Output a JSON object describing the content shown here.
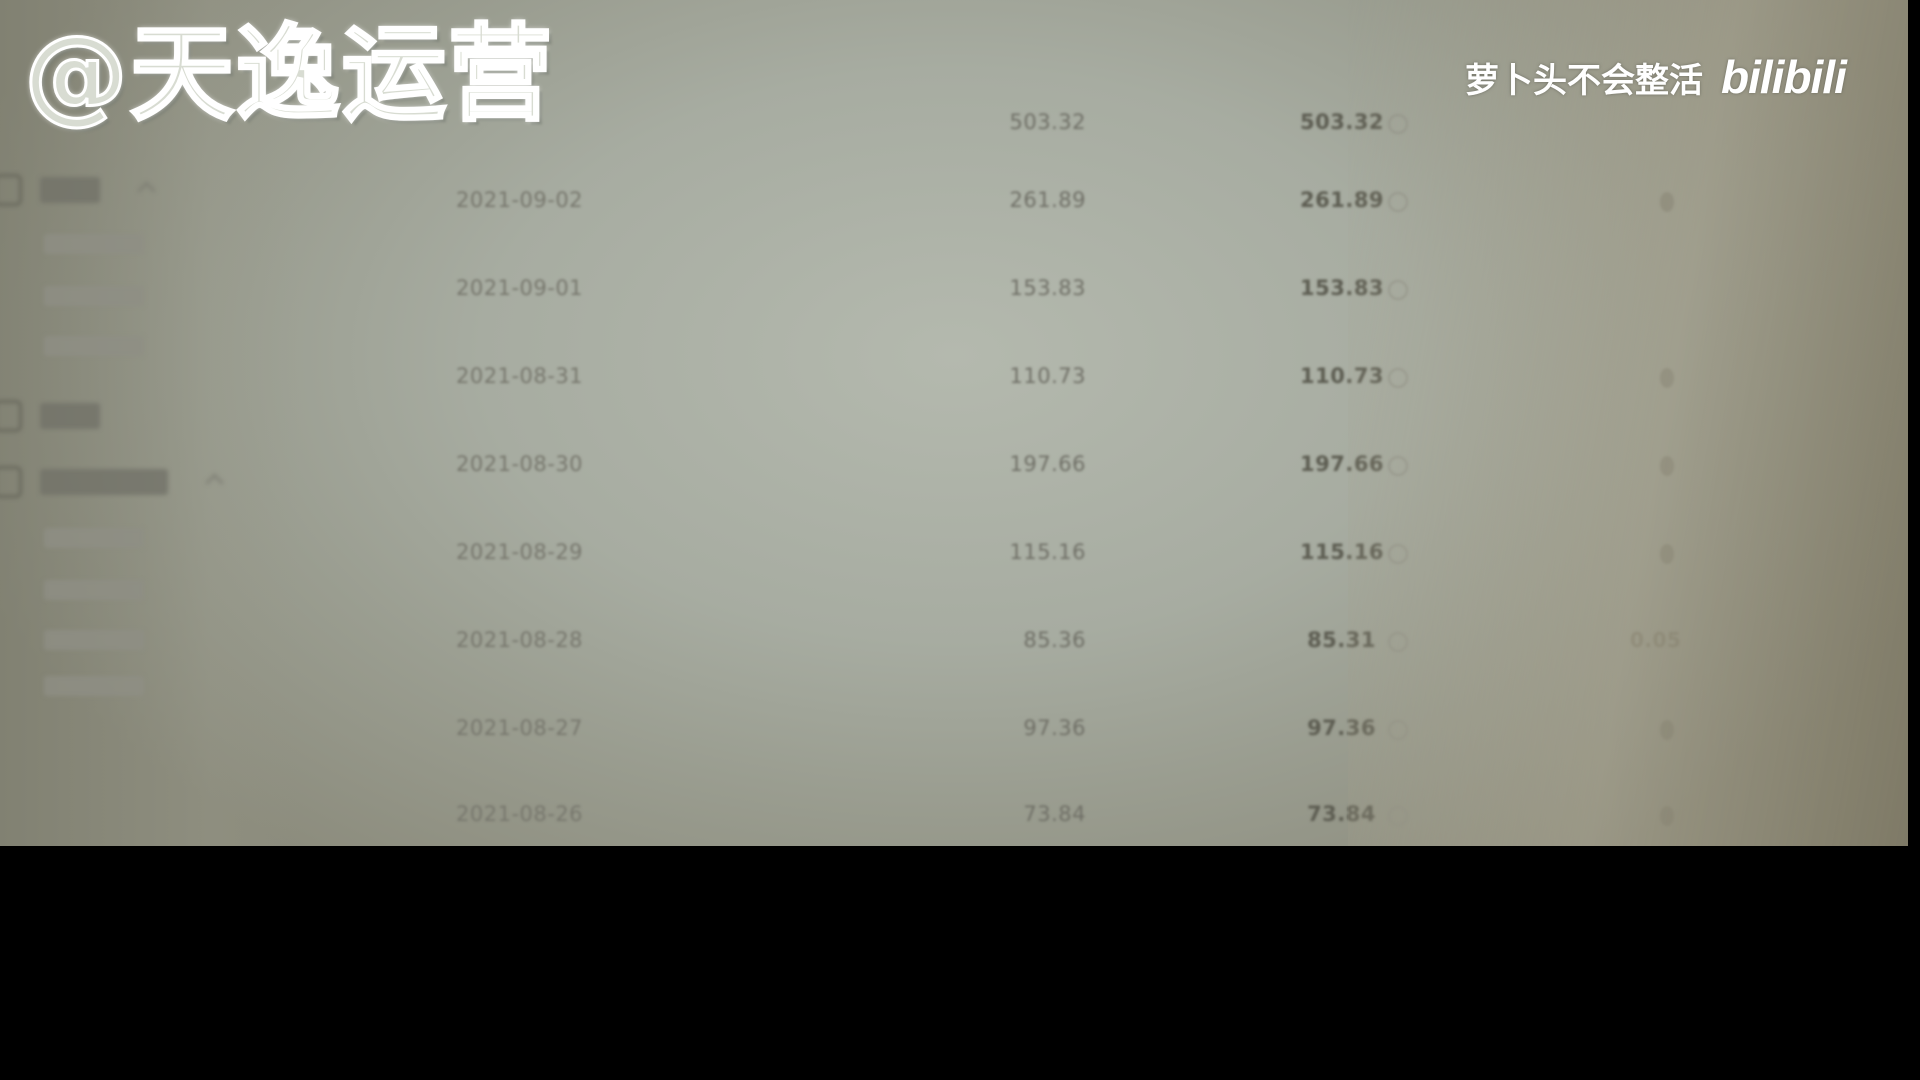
{
  "overlay": {
    "watermark": "@天逸运营",
    "uploader": "萝卜头不会整活",
    "logo": "bilibili"
  },
  "table": {
    "rows": [
      {
        "date": "",
        "amount": "503.32",
        "settled": "503.32",
        "extra": ""
      },
      {
        "date": "2021-09-02",
        "amount": "261.89",
        "settled": "261.89",
        "extra": ""
      },
      {
        "date": "2021-09-01",
        "amount": "153.83",
        "settled": "153.83",
        "extra": ""
      },
      {
        "date": "2021-08-31",
        "amount": "110.73",
        "settled": "110.73",
        "extra": ""
      },
      {
        "date": "2021-08-30",
        "amount": "197.66",
        "settled": "197.66",
        "extra": ""
      },
      {
        "date": "2021-08-29",
        "amount": "115.16",
        "settled": "115.16",
        "extra": ""
      },
      {
        "date": "2021-08-28",
        "amount": "85.36",
        "settled": "85.31",
        "extra": "0.05"
      },
      {
        "date": "2021-08-27",
        "amount": "97.36",
        "settled": "97.36",
        "extra": ""
      },
      {
        "date": "2021-08-26",
        "amount": "73.84",
        "settled": "73.84",
        "extra": ""
      }
    ]
  }
}
